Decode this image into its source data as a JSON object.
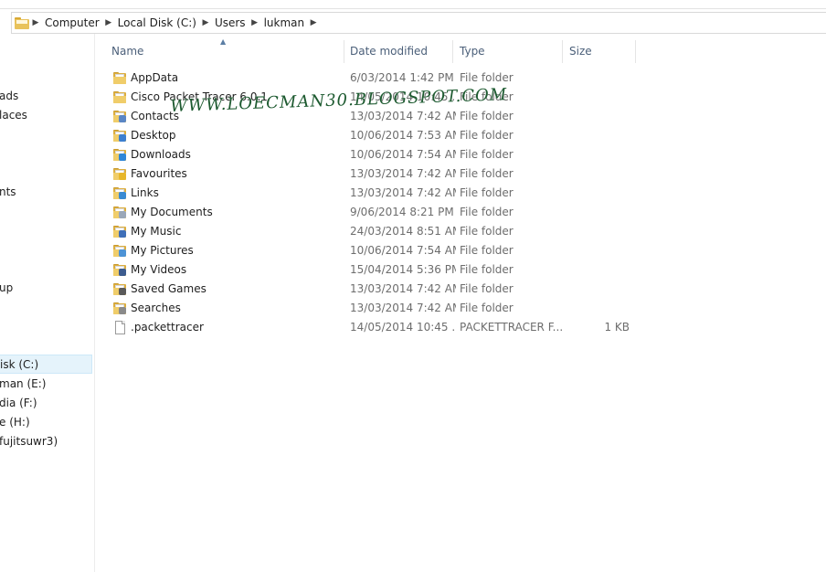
{
  "address_bar": {
    "crumbs": [
      "Computer",
      "Local Disk (C:)",
      "Users",
      "lukman"
    ]
  },
  "nav_pane": {
    "items": [
      {
        "label": "ads"
      },
      {
        "label": "laces"
      },
      {
        "label": "nts"
      },
      {
        "label": "up"
      },
      {
        "label": "isk (C:)",
        "selected": true
      },
      {
        "label": "man (E:)"
      },
      {
        "label": "dia (F:)"
      },
      {
        "label": "e (H:)"
      },
      {
        "label": "fujitsuwr3)"
      }
    ]
  },
  "columns": {
    "name": "Name",
    "date_modified": "Date modified",
    "type": "Type",
    "size": "Size"
  },
  "files": [
    {
      "name": "AppData",
      "date": "6/03/2014 1:42 PM",
      "type": "File folder",
      "size": "",
      "icon": "folder-icon"
    },
    {
      "name": "Cisco Packet Tracer 6.0.1",
      "date": "14/05/2014 10:45 ...",
      "type": "File folder",
      "size": "",
      "icon": "folder-icon"
    },
    {
      "name": "Contacts",
      "date": "13/03/2014 7:42 AM",
      "type": "File folder",
      "size": "",
      "icon": "contacts-folder-icon"
    },
    {
      "name": "Desktop",
      "date": "10/06/2014 7:53 AM",
      "type": "File folder",
      "size": "",
      "icon": "desktop-folder-icon"
    },
    {
      "name": "Downloads",
      "date": "10/06/2014 7:54 AM",
      "type": "File folder",
      "size": "",
      "icon": "downloads-folder-icon"
    },
    {
      "name": "Favourites",
      "date": "13/03/2014 7:42 AM",
      "type": "File folder",
      "size": "",
      "icon": "favourites-folder-icon"
    },
    {
      "name": "Links",
      "date": "13/03/2014 7:42 AM",
      "type": "File folder",
      "size": "",
      "icon": "links-folder-icon"
    },
    {
      "name": "My Documents",
      "date": "9/06/2014 8:21 PM",
      "type": "File folder",
      "size": "",
      "icon": "documents-folder-icon"
    },
    {
      "name": "My Music",
      "date": "24/03/2014 8:51 AM",
      "type": "File folder",
      "size": "",
      "icon": "music-folder-icon"
    },
    {
      "name": "My Pictures",
      "date": "10/06/2014 7:54 AM",
      "type": "File folder",
      "size": "",
      "icon": "pictures-folder-icon"
    },
    {
      "name": "My Videos",
      "date": "15/04/2014 5:36 PM",
      "type": "File folder",
      "size": "",
      "icon": "videos-folder-icon"
    },
    {
      "name": "Saved Games",
      "date": "13/03/2014 7:42 AM",
      "type": "File folder",
      "size": "",
      "icon": "saved-games-folder-icon"
    },
    {
      "name": "Searches",
      "date": "13/03/2014 7:42 AM",
      "type": "File folder",
      "size": "",
      "icon": "searches-folder-icon"
    },
    {
      "name": ".packettracer",
      "date": "14/05/2014 10:45 ...",
      "type": "PACKETTRACER F...",
      "size": "1 KB",
      "icon": "file-icon"
    }
  ],
  "watermark": "WWW.LOECMAN30.BLOGSPOT.COM",
  "colors": {
    "folder_yellow": "#f0cd6a",
    "selection_blue": "#e5f3fb",
    "header_text": "#4c607a",
    "watermark_green": "#1d5a30"
  }
}
